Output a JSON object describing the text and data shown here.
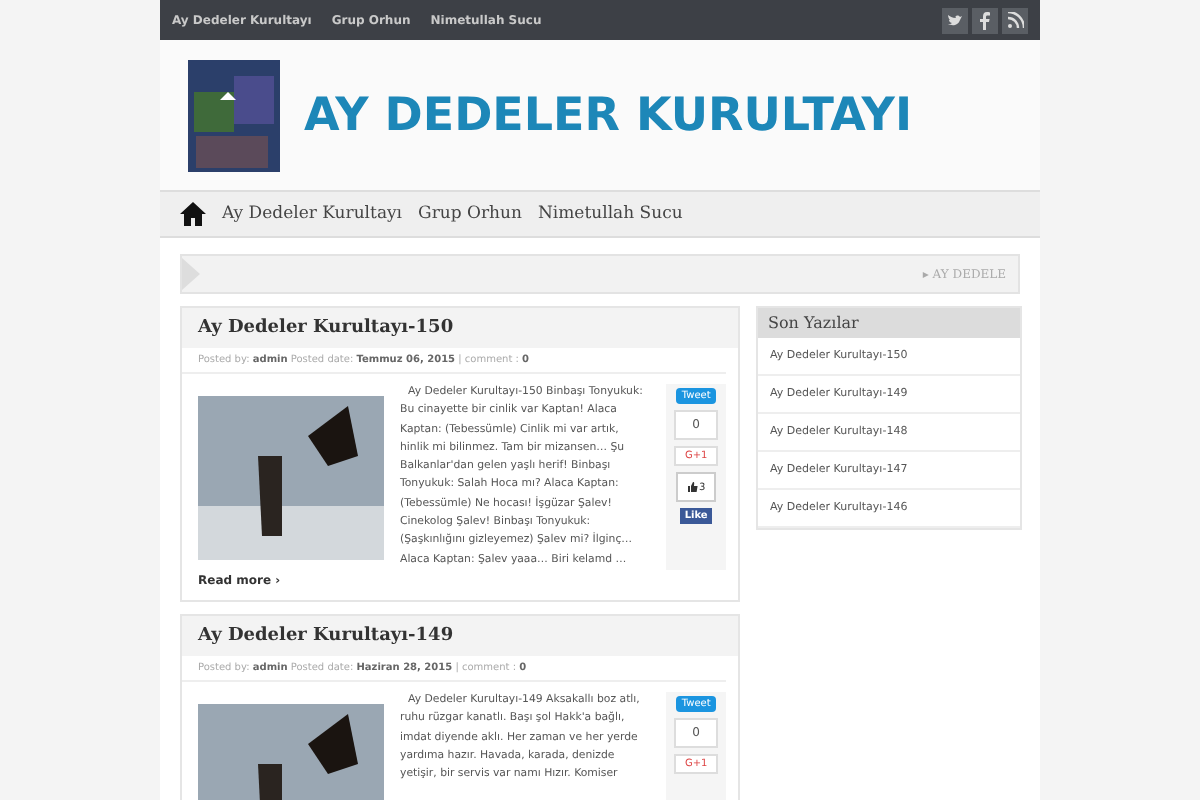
{
  "top_bar": {
    "links": [
      "Ay Dedeler Kurultayı",
      "Grup Orhun",
      "Nimetullah Sucu"
    ]
  },
  "header": {
    "title": "AY DEDELER KURULTAYI"
  },
  "nav": {
    "items": [
      "Ay Dedeler Kurultayı",
      "Grup Orhun",
      "Nimetullah Sucu"
    ]
  },
  "breadcrumb": {
    "marker": "▸",
    "text": "AY DEDELE"
  },
  "posts": [
    {
      "title": "Ay Dedeler Kurultayı-150",
      "meta": {
        "posted_by_label": "Posted by:",
        "author": "admin",
        "date_label": "Posted date:",
        "date": "Temmuz 06, 2015",
        "separator": "|",
        "comment_label": "comment :",
        "comments": "0"
      },
      "excerpt": "Ay Dedeler Kurultayı-150 Binbaşı Tonyukuk: Bu cinayette bir cinlik var Kaptan! Alaca Kaptan: (Tebessümle) Cinlik mi var artık, hinlik mi bilinmez. Tam bir mizansen… Şu Balkanlar'dan gelen yaşlı herif! Binbaşı Tonyukuk: Salah Hoca mı? Alaca Kaptan: (Tebessümle) Ne hocası! İşgüzar Şalev! Cinekolog Şalev! Binbaşı Tonyukuk: (Şaşkınlığını gizleyemez) Şalev mi? İlginç… Alaca Kaptan: Şalev yaaa… Biri kelamd …",
      "read_more": "Read more",
      "read_more_marker": "›",
      "share": {
        "tweet": "Tweet",
        "count": "0",
        "gplus": "G+1",
        "likes": "3",
        "like": "Like"
      }
    },
    {
      "title": "Ay Dedeler Kurultayı-149",
      "meta": {
        "posted_by_label": "Posted by:",
        "author": "admin",
        "date_label": "Posted date:",
        "date": "Haziran 28, 2015",
        "separator": "|",
        "comment_label": "comment :",
        "comments": "0"
      },
      "excerpt": "Ay Dedeler Kurultayı-149 Aksakallı boz atlı, ruhu rüzgar kanatlı. Başı şol Hakk'a bağlı, imdat diyende aklı. Her zaman ve her yerde yardıma hazır. Havada, karada, denizde yetişir, bir servis var namı Hızır. Komiser",
      "share": {
        "tweet": "Tweet",
        "count": "0",
        "gplus": "G+1"
      }
    }
  ],
  "sidebar": {
    "title": "Son Yazılar",
    "items": [
      "Ay Dedeler Kurultayı-150",
      "Ay Dedeler Kurultayı-149",
      "Ay Dedeler Kurultayı-148",
      "Ay Dedeler Kurultayı-147",
      "Ay Dedeler Kurultayı-146"
    ]
  }
}
